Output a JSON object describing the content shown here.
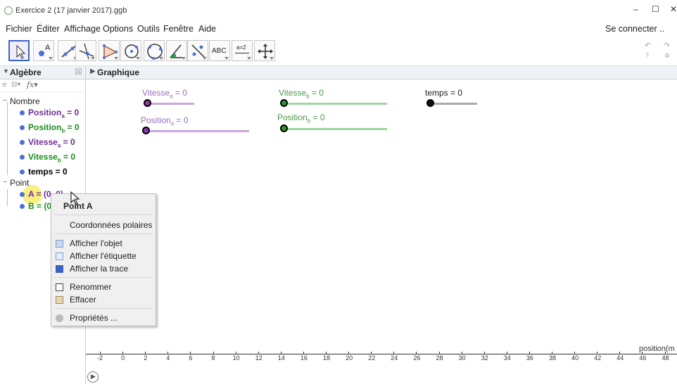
{
  "window": {
    "title": "Exercice 2 (17 janvier 2017).ggb",
    "minimize": "–",
    "maximize": "☐",
    "close": "✕"
  },
  "menu": {
    "items": [
      "Fichier",
      "Éditer",
      "Affichage",
      "Options",
      "Outils",
      "Fenêtre",
      "Aide"
    ],
    "signin": "Se connecter .."
  },
  "toolbar": {
    "tools": [
      "move-tool-icon",
      "point-tool-icon",
      "line-tool-icon",
      "perpendicular-tool-icon",
      "polygon-tool-icon",
      "circle-tool-icon",
      "circle-three-points-icon",
      "angle-tool-icon",
      "reflect-tool-icon",
      "text-tool-icon",
      "slider-tool-icon",
      "move-graphics-icon"
    ],
    "text_tool": "ABC",
    "slider_tool": "a=2",
    "undo": "↶",
    "redo": "↷",
    "help": "?",
    "settings": "⚙"
  },
  "algebra": {
    "title": "Algèbre",
    "close": "☒",
    "categories": {
      "nombre": "Nombre",
      "point": "Point"
    },
    "items": {
      "pos_a": {
        "name": "Position",
        "sub": "a",
        "value": " = 0",
        "color": "#6f2c91"
      },
      "pos_b": {
        "name": "Position",
        "sub": "b",
        "value": " = 0",
        "color": "#1d8c1d"
      },
      "vit_a": {
        "name": "Vitesse",
        "sub": "a",
        "value": " = 0",
        "color": "#6f2c91"
      },
      "vit_b": {
        "name": "Vitesse",
        "sub": "b",
        "value": " = 0",
        "color": "#1d8c1d"
      },
      "temps": {
        "text": "temps = 0",
        "color": "#000000"
      },
      "pt_a": {
        "text": "A = (0, 0)",
        "color": "#6f2c91"
      },
      "pt_b": {
        "text": "B = (0",
        "color": "#1d8c1d"
      }
    }
  },
  "graphics": {
    "title": "Graphique",
    "sliders": {
      "vit_a": {
        "name": "Vitesse",
        "sub": "a",
        "value": " = 0",
        "color": "#c8a8dd",
        "knob": "#8b3ab0"
      },
      "vit_b": {
        "name": "Vitesse",
        "sub": "b",
        "value": " = 0",
        "color": "#9fd39f",
        "knob": "#2a9a2a"
      },
      "temps": {
        "text": "temps = 0",
        "color": "#a8a8a8",
        "knob": "#111111"
      },
      "pos_a": {
        "name": "Position",
        "sub": "a",
        "value": " = 0",
        "color": "#c8a8dd",
        "knob": "#8b3ab0"
      },
      "pos_b": {
        "name": "Position",
        "sub": "b",
        "value": " = 0",
        "color": "#9fd39f",
        "knob": "#2a9a2a"
      }
    },
    "axis_label": "position(m",
    "ticks": [
      "-2",
      "0",
      "2",
      "4",
      "6",
      "8",
      "10",
      "12",
      "14",
      "16",
      "18",
      "20",
      "22",
      "24",
      "26",
      "28",
      "30",
      "32",
      "34",
      "36",
      "38",
      "40",
      "42",
      "44",
      "46",
      "48"
    ]
  },
  "context_menu": {
    "title": "Point A",
    "items": {
      "polar": "Coordonnées polaires",
      "show_object": "Afficher l'objet",
      "show_label": "Afficher l'étiquette",
      "show_trace": "Afficher la trace",
      "rename": "Renommer",
      "delete": "Effacer",
      "properties": "Propriétés ..."
    }
  },
  "play_button": "▶"
}
